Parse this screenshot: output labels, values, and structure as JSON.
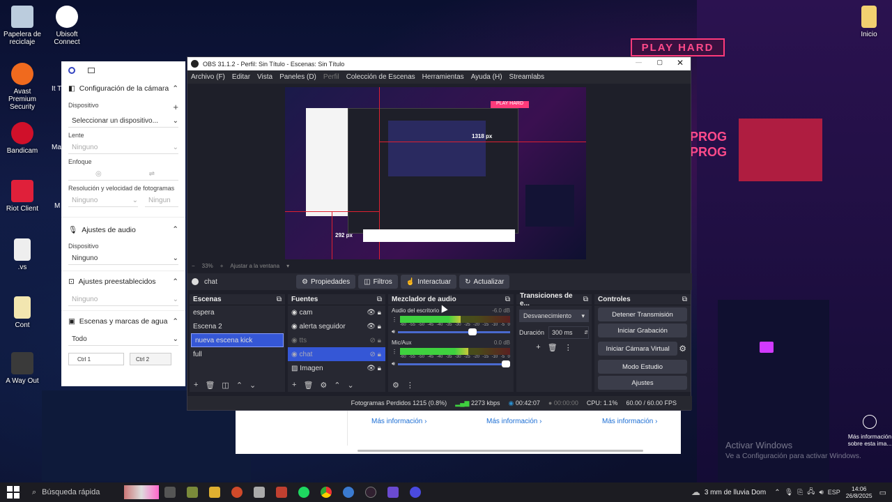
{
  "desktop": {
    "icons": [
      {
        "label": "Papelera de reciclaje",
        "name": "recycle-bin-icon"
      },
      {
        "label": "Ubisoft Connect",
        "name": "ubisoft-connect-icon"
      },
      {
        "label": "Avast Premium Security",
        "name": "avast-icon"
      },
      {
        "label": "Bandicam",
        "name": "bandicam-icon"
      },
      {
        "label": "Riot Client",
        "name": "riot-client-icon"
      },
      {
        "label": ".vs",
        "name": "vs-file-icon"
      },
      {
        "label": "Cont",
        "name": "folder-icon"
      },
      {
        "label": "A Way Out",
        "name": "a-way-out-icon"
      },
      {
        "label": "Inicio",
        "name": "inicio-icon"
      }
    ],
    "partial_labels": [
      "It T",
      "Ma",
      "M"
    ],
    "neon_sign": "PLAY HARD",
    "neon_sign2": "PROG\nPROG",
    "more_info": "Más información sobre esta ima...",
    "watermark_title": "Activar Windows",
    "watermark_sub": "Ve a Configuración para activar Windows."
  },
  "camera_panel": {
    "sections": [
      {
        "title": "Configuración de la cámara",
        "icon": "camera-icon"
      },
      {
        "title": "Ajustes de audio",
        "icon": "mic-icon"
      },
      {
        "title": "Ajustes preestablecidos",
        "icon": "preset-icon"
      },
      {
        "title": "Escenas y marcas de agua",
        "icon": "scenes-icon"
      }
    ],
    "device_label": "Dispositivo",
    "device_value": "Seleccionar un dispositivo...",
    "lens_label": "Lente",
    "lens_value": "Ninguno",
    "focus_label": "Enfoque",
    "res_label": "Resolución y velocidad de fotogramas",
    "res_value": "Ninguno",
    "res_value2": "Ningun",
    "audio_device_label": "Dispositivo",
    "audio_device_value": "Ninguno",
    "preset_value": "Ninguno",
    "watermark_value": "Todo",
    "hotkey1": "Ctrl 1",
    "hotkey2": "Ctrl 2"
  },
  "obs": {
    "title": "OBS 31.1.2 - Perfil: Sin Título - Escenas: Sin Título",
    "menu": [
      "Archivo (F)",
      "Editar",
      "Vista",
      "Paneles (D)",
      "Perfil",
      "Colección de Escenas",
      "Herramientas",
      "Ayuda (H)",
      "Streamlabs"
    ],
    "preview_labels": {
      "w": "1318 px",
      "h": "292 px",
      "sign": "PLAY HARD"
    },
    "zoom": "33%",
    "fit": "Ajustar a la ventana",
    "selected_source": "chat",
    "source_buttons": [
      "Propiedades",
      "Filtros",
      "Interactuar",
      "Actualizar"
    ],
    "scenes_title": "Escenas",
    "scenes": [
      "espera",
      "Escena 2",
      "nueva escena kick",
      "full"
    ],
    "scene_selected": 2,
    "sources_title": "Fuentes",
    "sources": [
      {
        "name": "cam",
        "visible": true
      },
      {
        "name": "alerta seguidor",
        "visible": true
      },
      {
        "name": "tts",
        "visible": false
      },
      {
        "name": "chat",
        "visible": false
      },
      {
        "name": "Imagen",
        "visible": true
      }
    ],
    "source_selected": 3,
    "mixer_title": "Mezclador de audio",
    "mixer": [
      {
        "name": "Audio del escritorio",
        "db": "-6.0 dB",
        "level": 0.55,
        "volume": 0.7
      },
      {
        "name": "Mic/Aux",
        "db": "0.0 dB",
        "level": 0.62,
        "volume": 1.0
      }
    ],
    "meter_ticks": [
      "-60",
      "-55",
      "-50",
      "-45",
      "-40",
      "-35",
      "-30",
      "-25",
      "-20",
      "-15",
      "-10",
      "-5",
      "0"
    ],
    "transitions_title": "Transiciones de e...",
    "transition": "Desvanecimiento",
    "duration_label": "Duración",
    "duration": "300 ms",
    "controls_title": "Controles",
    "controls": [
      "Detener Transmisión",
      "Iniciar Grabación",
      "Iniciar Cámara Virtual",
      "Modo Estudio",
      "Ajustes"
    ],
    "status": {
      "dropped": "Fotogramas Perdidos 1215 (0.8%)",
      "kbps": "2273 kbps",
      "live_time": "00:42:07",
      "rec_time": "00:00:00",
      "cpu": "CPU: 1.1%",
      "fps": "60.00 / 60.00 FPS"
    }
  },
  "web": {
    "links": [
      "Más información ›",
      "Más información ›",
      "Más información ›"
    ]
  },
  "taskbar": {
    "search": "Búsqueda rápida",
    "weather": "3 mm de lluvia Dom",
    "lang": "ESP",
    "time": "14:06",
    "date": "26/8/2025"
  },
  "colors": {
    "obs_bg": "#1e1f29",
    "dock_bg": "#272832",
    "selected": "#3557d6",
    "meter_green": "#3fd13f",
    "meter_yellow": "#c8c83a",
    "meter_red": "#c83a3a"
  }
}
